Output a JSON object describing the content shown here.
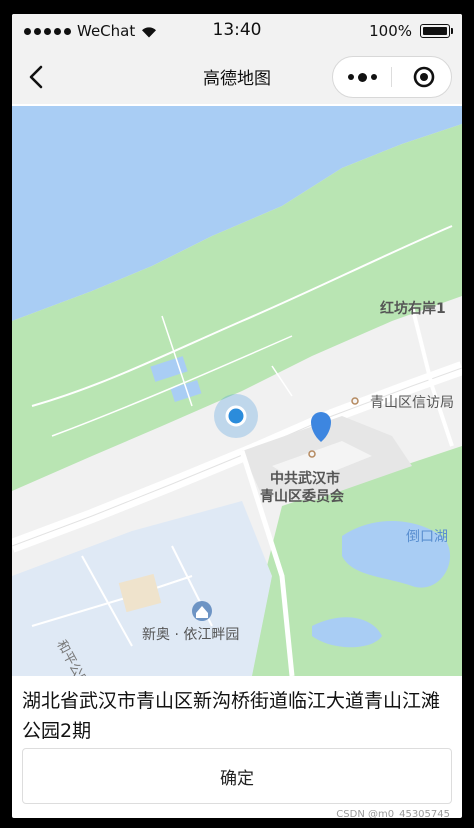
{
  "status_bar": {
    "carrier": "WeChat",
    "time": "13:40",
    "battery": "100%"
  },
  "nav": {
    "title": "高德地图"
  },
  "map": {
    "labels": {
      "hongfang": "红坊右岸1",
      "xinfang": "青山区信访局",
      "party_line1": "中共武汉市",
      "party_line2": "青山区委员会",
      "daokou_lake": "倒口湖",
      "yijiang": "新奥 · 依江畔园",
      "road": "和平公园"
    }
  },
  "address": "湖北省武汉市青山区新沟桥街道临江大道青山江滩公园2期",
  "confirm_label": "确定",
  "watermark": "CSDN @m0_45305745",
  "colors": {
    "water": "#a9cdf4",
    "park": "#b9e5b3",
    "residential": "#dfe9f5",
    "road": "#ffffff",
    "location": "#2b8cdb"
  }
}
